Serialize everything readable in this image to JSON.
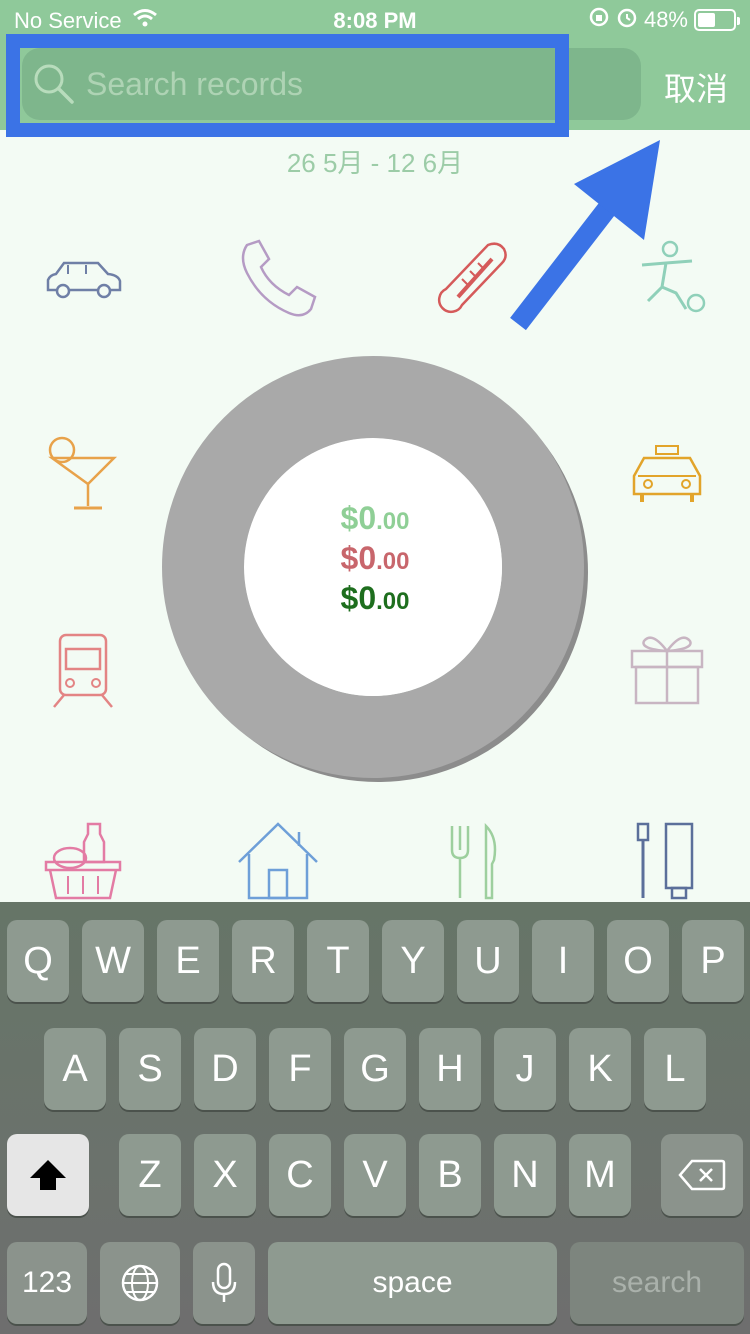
{
  "status_bar": {
    "carrier": "No Service",
    "time": "8:08 PM",
    "battery": "48%"
  },
  "search": {
    "placeholder": "Search records",
    "value": "",
    "cancel_label": "取消"
  },
  "date_range": "26 5月 - 12 6月",
  "categories": [
    {
      "icon": "car-icon",
      "color": "#6f7fa6"
    },
    {
      "icon": "phone-icon",
      "color": "#b59bc4"
    },
    {
      "icon": "thermometer-icon",
      "color": "#d55a5a"
    },
    {
      "icon": "soccer-player-icon",
      "color": "#8fd0b9"
    },
    {
      "icon": "cocktail-icon",
      "color": "#e8a24a"
    },
    {
      "icon": "taxi-icon",
      "color": "#e2a42a"
    },
    {
      "icon": "train-icon",
      "color": "#e38484"
    },
    {
      "icon": "gift-icon",
      "color": "#c8b5c2"
    },
    {
      "icon": "grocery-basket-icon",
      "color": "#e37ba4"
    },
    {
      "icon": "house-icon",
      "color": "#6e9fd8"
    },
    {
      "icon": "fork-knife-icon",
      "color": "#9dcf9e"
    },
    {
      "icon": "toothbrush-icon",
      "color": "#5b6f9a"
    }
  ],
  "totals": {
    "income": {
      "whole": "$0",
      "cents": ".00",
      "color": "#8fcf96"
    },
    "expense": {
      "whole": "$0",
      "cents": ".00",
      "color": "#c8666c"
    },
    "balance": {
      "whole": "$0",
      "cents": ".00",
      "color": "#1e6e1e"
    }
  },
  "keyboard": {
    "row1": [
      "Q",
      "W",
      "E",
      "R",
      "T",
      "Y",
      "U",
      "I",
      "O",
      "P"
    ],
    "row2": [
      "A",
      "S",
      "D",
      "F",
      "G",
      "H",
      "J",
      "K",
      "L"
    ],
    "row3": [
      "Z",
      "X",
      "C",
      "V",
      "B",
      "N",
      "M"
    ],
    "numbers_label": "123",
    "space_label": "space",
    "search_label": "search"
  }
}
